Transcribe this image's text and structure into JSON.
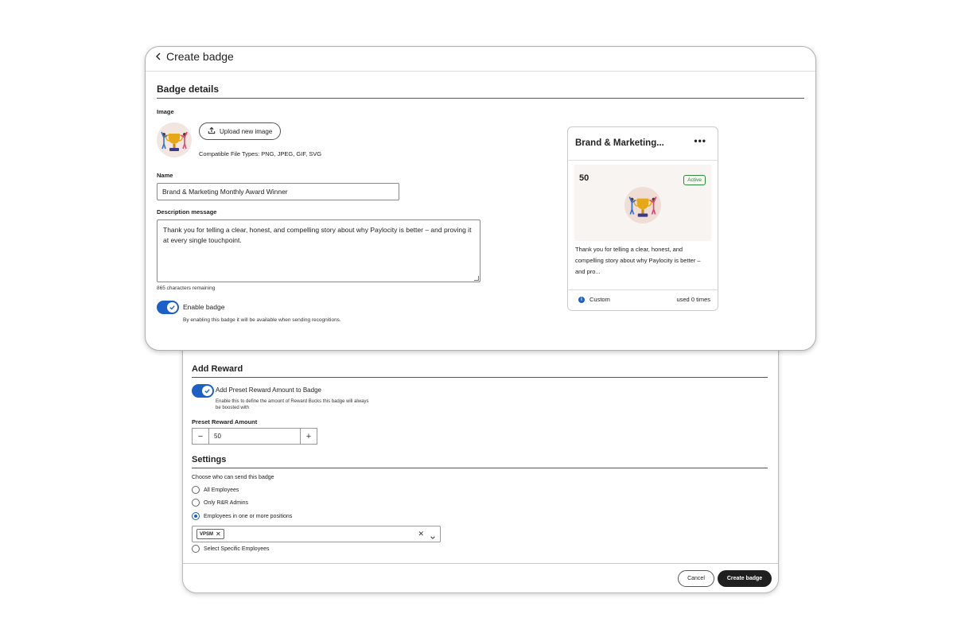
{
  "header": {
    "title": "Create badge"
  },
  "details": {
    "section_title": "Badge details",
    "image_label": "Image",
    "upload_label": "Upload new image",
    "file_types": "Compatible File Types: PNG, JPEG, GIF, SVG",
    "name_label": "Name",
    "name_value": "Brand & Marketing Monthly Award Winner",
    "description_label": "Description message",
    "description_value": "Thank you for telling a clear, honest, and compelling story about why Paylocity is better – and proving it at every single touchpoint.",
    "chars_remaining": "865 characters remaining",
    "enable_label": "Enable badge",
    "enable_help": "By enabling this badge it will be available when sending recognitions."
  },
  "preview": {
    "title": "Brand & Marketing...",
    "more": "•••",
    "count": "50",
    "status": "Active",
    "description": "Thank you for telling a clear, honest, and compelling story about why Paylocity is better – and pro...",
    "type": "Custom",
    "usage": "used 0 times"
  },
  "reward": {
    "section_title": "Add Reward",
    "toggle_label": "Add Preset Reward Amount to Badge",
    "toggle_help": "Enable this to define the amount of Reward Bucks this badge will always be boosted with",
    "amount_label": "Preset Reward Amount",
    "amount_value": "50",
    "minus": "−",
    "plus": "+"
  },
  "settings": {
    "section_title": "Settings",
    "question": "Choose who can send this badge",
    "options": [
      "All Employees",
      "Only R&R Admins",
      "Employees in one or more positions",
      "Select Specific Employees"
    ],
    "selected_index": 2,
    "chip": "VPSM"
  },
  "footer": {
    "cancel": "Cancel",
    "create": "Create badge"
  },
  "colors": {
    "accent": "#1b5fc7",
    "active_green": "#2b8a3e",
    "dark_button": "#1f1f1f"
  }
}
